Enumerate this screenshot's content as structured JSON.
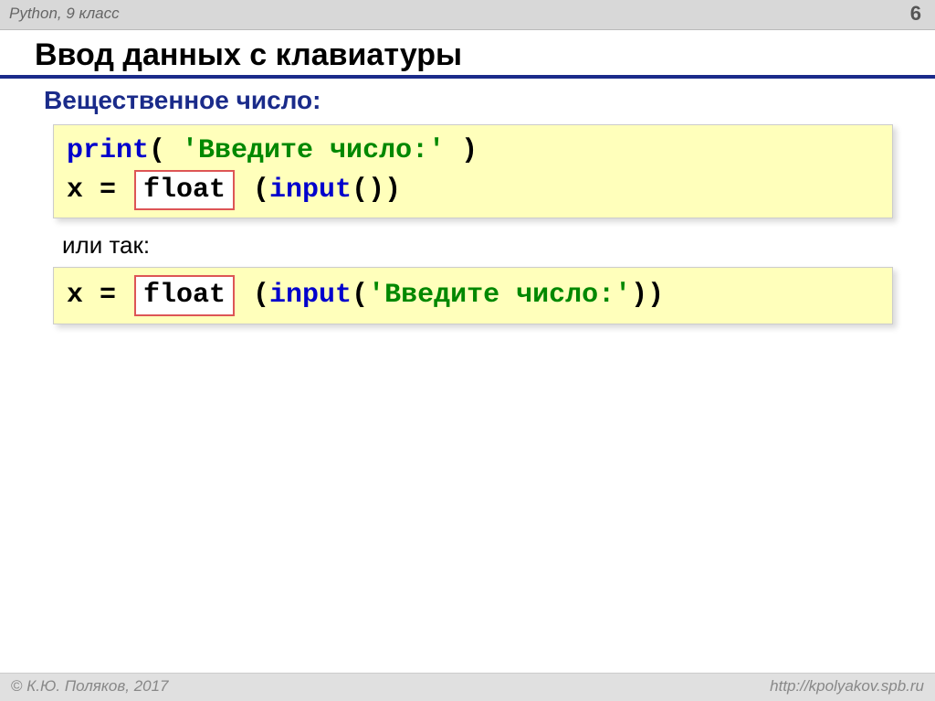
{
  "header": {
    "course": "Python, 9 класс",
    "pageNumber": "6"
  },
  "title": "Ввод данных с клавиатуры",
  "subtitle": "Вещественное число:",
  "code1": {
    "print_kw": "print",
    "print_arg_open": "( ",
    "print_str": "'Введите число:'",
    "print_arg_close": " )",
    "assign": "x = ",
    "float_box": "float",
    "after_float": " (",
    "input_kw": "input",
    "after_input": "())"
  },
  "middleText": "или так:",
  "code2": {
    "assign": "x = ",
    "float_box": "float",
    "after_float": " (",
    "input_kw": "input",
    "paren_open": "(",
    "input_str": "'Введите число:'",
    "paren_close": "))"
  },
  "footer": {
    "copyright": " К.Ю. Поляков, 2017",
    "url": "http://kpolyakov.spb.ru"
  }
}
